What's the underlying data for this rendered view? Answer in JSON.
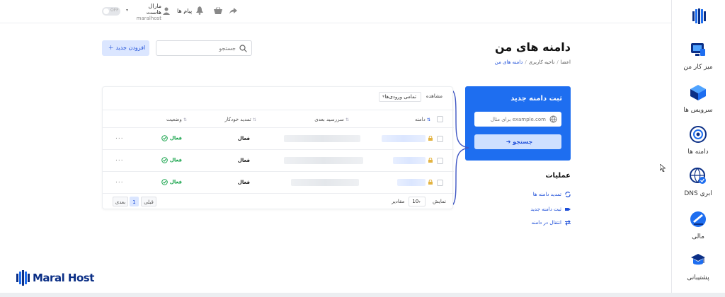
{
  "topbar": {
    "toggle_text": "OFF",
    "user_name": "مارال هاست",
    "user_handle": "maralhost",
    "messages_label": "پیام ها"
  },
  "sidebar": {
    "items": [
      {
        "label": "میز کار من",
        "icon": "desk-icon"
      },
      {
        "label": "سرویس ها",
        "icon": "services-icon"
      },
      {
        "label": "دامنه ها",
        "icon": "domains-icon"
      },
      {
        "label": "DNS ابری",
        "icon": "cloud-dns-icon"
      },
      {
        "label": "مالی",
        "icon": "finance-icon"
      },
      {
        "label": "پشتیبانی",
        "icon": "support-icon"
      }
    ]
  },
  "page": {
    "title": "دامنه های من",
    "breadcrumb": [
      "اعضا",
      "ناحیه کاربری",
      "دامنه های من"
    ]
  },
  "search": {
    "placeholder": "جستجو"
  },
  "add_button": {
    "label": "افزودن جدید"
  },
  "register": {
    "title": "ثبت دامنه جدید",
    "placeholder": "برای مثال example.com",
    "button": "جستجو"
  },
  "operations": {
    "title": "عملیات",
    "items": [
      "تمدید دامنه ها",
      "ثبت دامنه جدید",
      "انتقال در دامنه"
    ]
  },
  "table": {
    "show_label": "مشاهده",
    "filter_value": "تمامی ورودی‌ها",
    "columns": {
      "domain": "دامنه",
      "next_due": "سررسید بعدی",
      "auto_renew": "تمدید خودکار",
      "status": "وضعیت"
    },
    "rows": [
      {
        "auto_renew": "فعال",
        "status": "فعال",
        "actions": "..."
      },
      {
        "auto_renew": "فعال",
        "status": "فعال",
        "actions": "..."
      },
      {
        "auto_renew": "فعال",
        "status": "فعال",
        "actions": "..."
      }
    ],
    "footer": {
      "show_text": "نمایش",
      "per_page": "10",
      "per_page_suffix": "مقادیر",
      "prev": "قبلی",
      "page": "1",
      "next": "بعدی"
    }
  },
  "brand": {
    "name": "Maral Host",
    "accent": "#1e6ef0",
    "dark": "#0b2f86"
  }
}
